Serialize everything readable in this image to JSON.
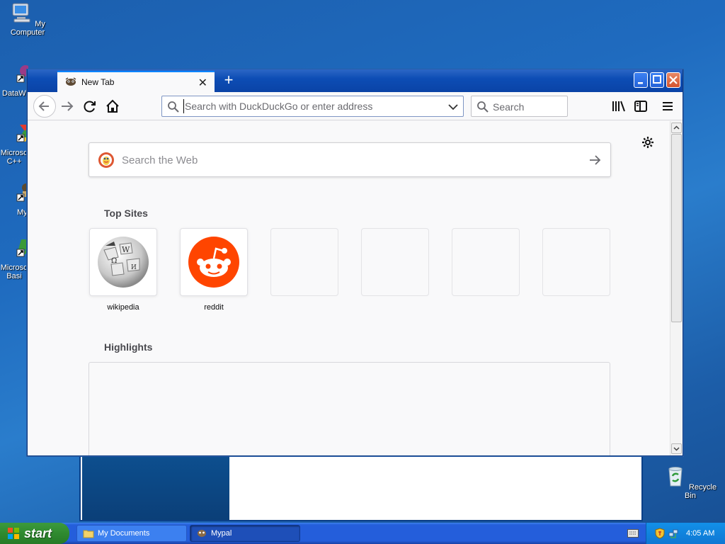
{
  "desktop": {
    "icons": [
      {
        "label": "My Computer"
      },
      {
        "label": "DataW"
      },
      {
        "label": "Microso\nC++"
      },
      {
        "label": "My"
      },
      {
        "label": "Microso\nBasi"
      },
      {
        "label": "Recycle Bin"
      }
    ]
  },
  "browser": {
    "tab": {
      "title": "New Tab"
    },
    "urlbar": {
      "placeholder": "Search with DuckDuckGo or enter address"
    },
    "searchbar": {
      "placeholder": "Search"
    },
    "newtab": {
      "web_search_placeholder": "Search the Web",
      "top_sites_title": "Top Sites",
      "top_sites": [
        {
          "label": "wikipedia"
        },
        {
          "label": "reddit"
        }
      ],
      "highlights_title": "Highlights"
    }
  },
  "taskbar": {
    "start_label": "start",
    "items": [
      {
        "label": "My Documents"
      },
      {
        "label": "Mypal"
      }
    ],
    "clock": "4:05 AM"
  },
  "colors": {
    "accent": "#0a84ff",
    "reddit": "#ff4500",
    "desktop": "#245edb"
  }
}
